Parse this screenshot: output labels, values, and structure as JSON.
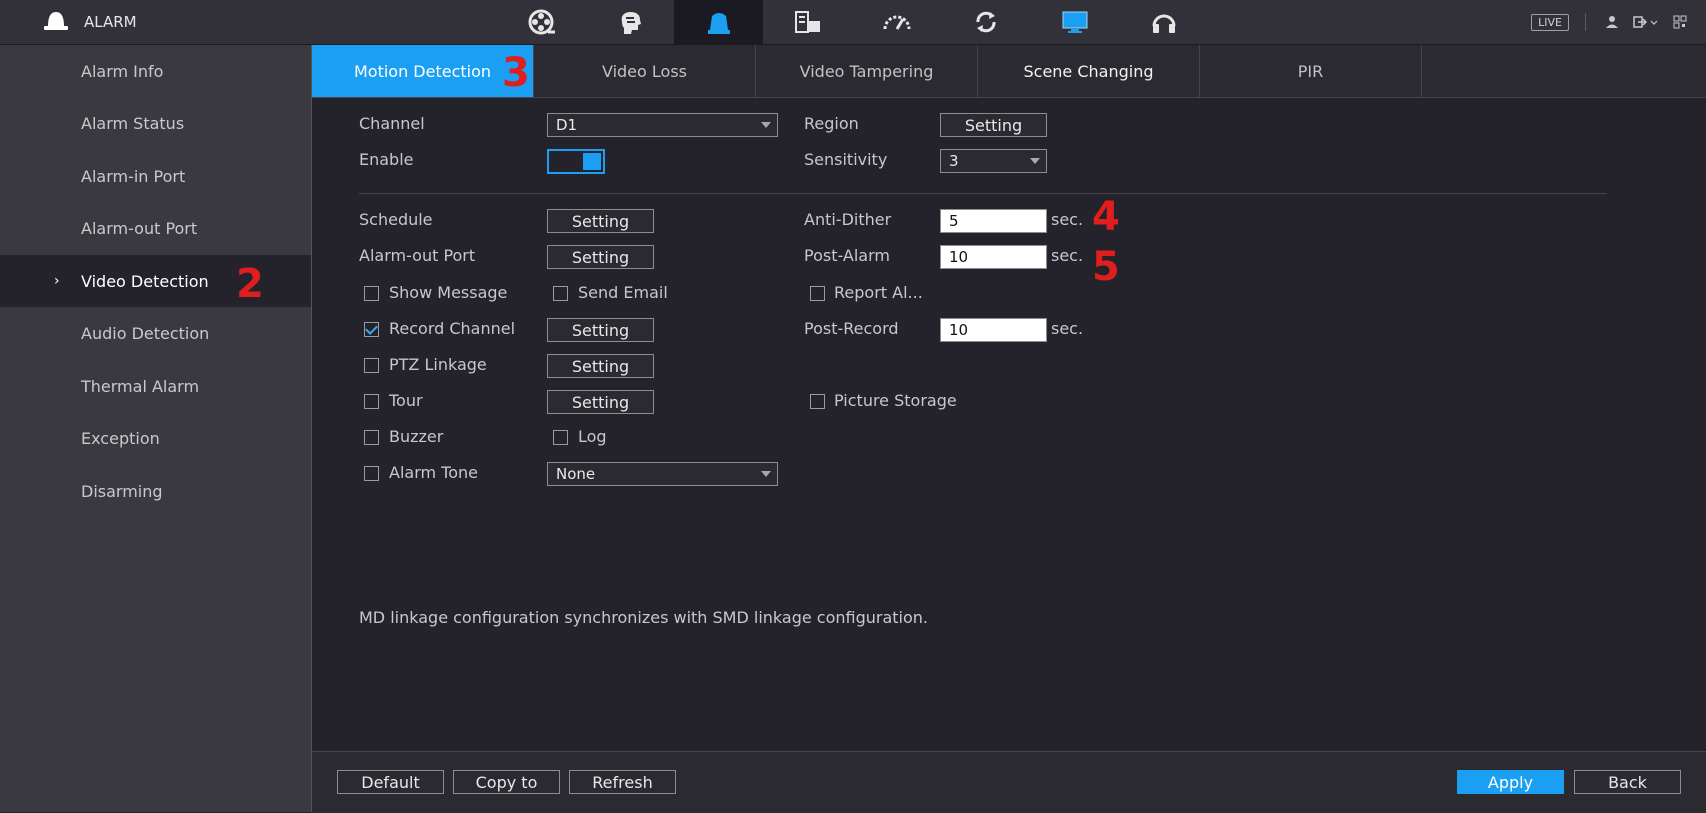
{
  "header": {
    "app_title": "ALARM",
    "nav_icons": [
      "film-reel-icon",
      "brain-icon",
      "alarm-light-icon",
      "storage-icon",
      "speedometer-icon",
      "refresh-icon",
      "monitor-icon",
      "headset-icon"
    ],
    "active_nav_index": 2,
    "live_label": "LIVE"
  },
  "sidebar": {
    "items": [
      {
        "label": "Alarm Info"
      },
      {
        "label": "Alarm Status"
      },
      {
        "label": "Alarm-in Port"
      },
      {
        "label": "Alarm-out Port"
      },
      {
        "label": "Video Detection",
        "active": true
      },
      {
        "label": "Audio Detection"
      },
      {
        "label": "Thermal Alarm"
      },
      {
        "label": "Exception"
      },
      {
        "label": "Disarming"
      }
    ]
  },
  "tabs": [
    {
      "label": "Motion Detection",
      "active": true
    },
    {
      "label": "Video Loss"
    },
    {
      "label": "Video Tampering"
    },
    {
      "label": "Scene Changing"
    },
    {
      "label": "PIR"
    }
  ],
  "annotations": {
    "sidebar": "2",
    "tab": "3",
    "anti_dither": "4",
    "post_alarm": "5"
  },
  "form": {
    "channel_label": "Channel",
    "channel_value": "D1",
    "region_label": "Region",
    "setting_label": "Setting",
    "enable_label": "Enable",
    "sensitivity_label": "Sensitivity",
    "sensitivity_value": "3",
    "schedule_label": "Schedule",
    "anti_dither_label": "Anti-Dither",
    "anti_dither_value": "5",
    "sec_label": "sec.",
    "alarm_out_label": "Alarm-out Port",
    "post_alarm_label": "Post-Alarm",
    "post_alarm_value": "10",
    "show_message_label": "Show Message",
    "send_email_label": "Send Email",
    "report_alarm_label": "Report Al...",
    "record_channel_label": "Record Channel",
    "post_record_label": "Post-Record",
    "post_record_value": "10",
    "ptz_linkage_label": "PTZ Linkage",
    "tour_label": "Tour",
    "picture_storage_label": "Picture Storage",
    "buzzer_label": "Buzzer",
    "log_label": "Log",
    "alarm_tone_label": "Alarm Tone",
    "alarm_tone_value": "None",
    "note": "MD linkage configuration synchronizes with SMD linkage configuration."
  },
  "footer": {
    "default_label": "Default",
    "copy_label": "Copy to",
    "refresh_label": "Refresh",
    "apply_label": "Apply",
    "back_label": "Back"
  },
  "colors": {
    "accent": "#1a9ff2",
    "annotation": "#e01e1e"
  }
}
